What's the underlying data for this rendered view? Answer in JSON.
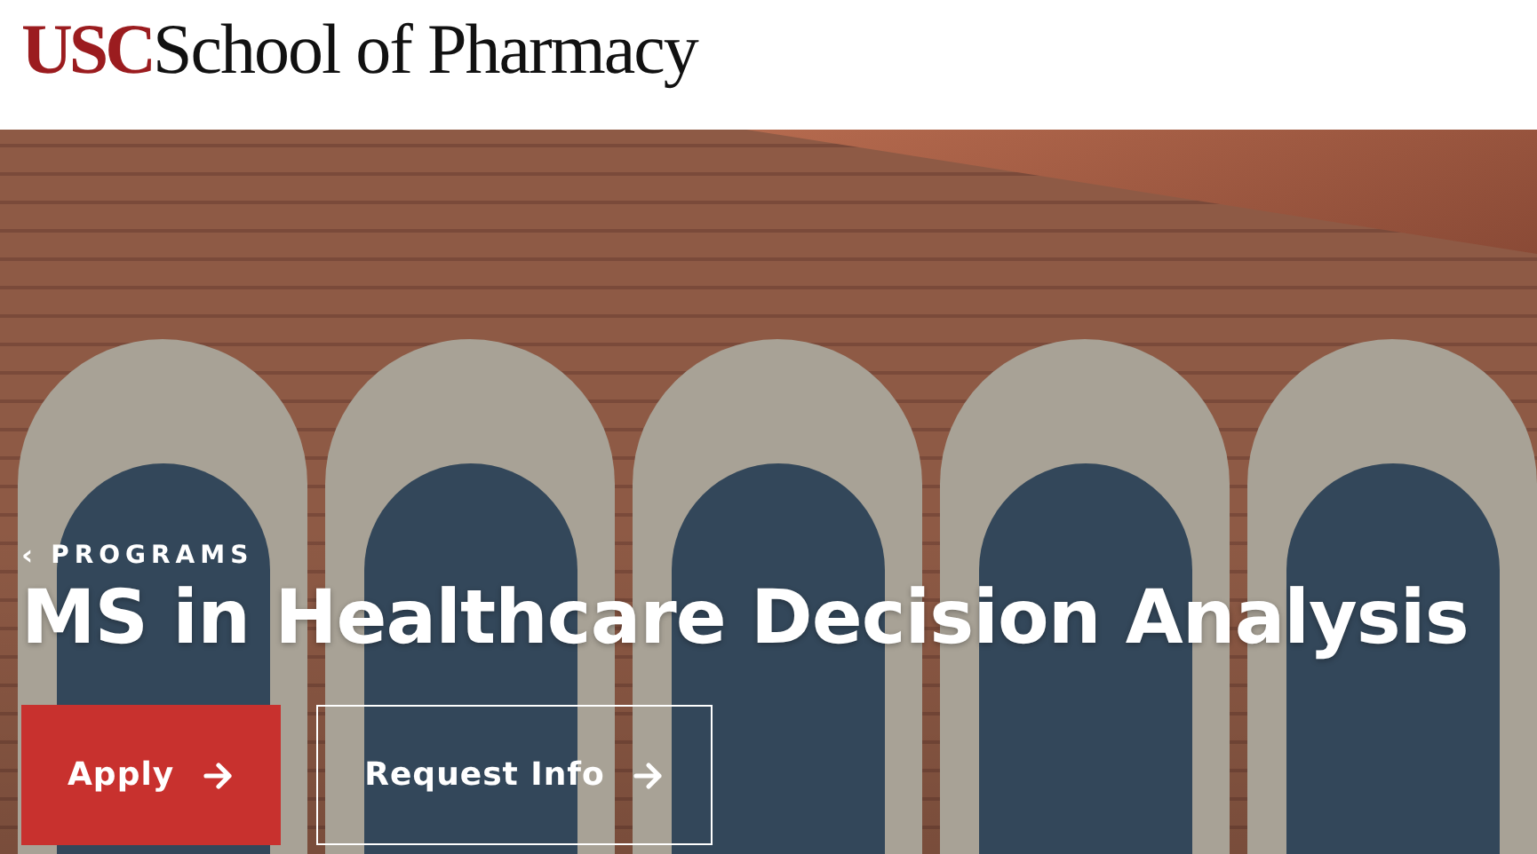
{
  "header": {
    "logo_mark": "USC",
    "logo_text": "School of Pharmacy"
  },
  "hero": {
    "breadcrumb": {
      "icon": "‹",
      "label": "PROGRAMS"
    },
    "title": "MS in Healthcare Decision Analysis",
    "buttons": [
      {
        "label": "Apply",
        "kind": "primary"
      },
      {
        "label": "Request Info",
        "kind": "outline"
      }
    ]
  }
}
